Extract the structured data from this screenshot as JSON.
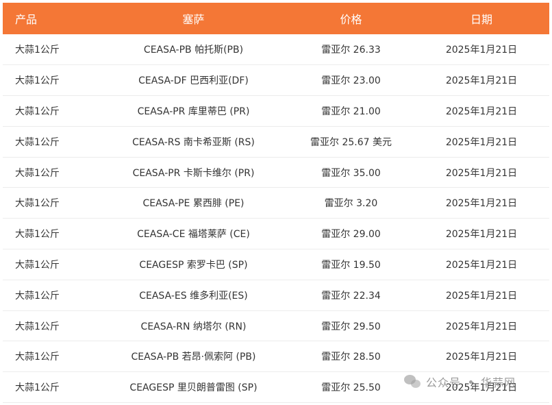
{
  "header": {
    "product": "产品",
    "market": "塞萨",
    "price": "价格",
    "date": "日期"
  },
  "rows": [
    {
      "product": "大蒜1公斤",
      "market": "CEASA-PB 帕托斯(PB)",
      "price": "雷亚尔 26.33",
      "date": "2025年1月21日"
    },
    {
      "product": "大蒜1公斤",
      "market": "CEASA-DF 巴西利亚(DF)",
      "price": "雷亚尔 23.00",
      "date": "2025年1月21日"
    },
    {
      "product": "大蒜1公斤",
      "market": "CEASA-PR 库里蒂巴 (PR)",
      "price": "雷亚尔 21.00",
      "date": "2025年1月21日"
    },
    {
      "product": "大蒜1公斤",
      "market": "CEASA-RS 南卡希亚斯 (RS)",
      "price": "雷亚尔 25.67 美元",
      "date": "2025年1月21日"
    },
    {
      "product": "大蒜1公斤",
      "market": "CEASA-PR 卡斯卡维尔 (PR)",
      "price": "雷亚尔 35.00",
      "date": "2025年1月21日"
    },
    {
      "product": "大蒜1公斤",
      "market": "CEASA-PE 累西腓 (PE)",
      "price": "雷亚尔 3.20",
      "date": "2025年1月21日"
    },
    {
      "product": "大蒜1公斤",
      "market": "CEASA-CE 福塔莱萨 (CE)",
      "price": "雷亚尔 29.00",
      "date": "2025年1月21日"
    },
    {
      "product": "大蒜1公斤",
      "market": "CEAGESP 索罗卡巴 (SP)",
      "price": "雷亚尔 19.50",
      "date": "2025年1月21日"
    },
    {
      "product": "大蒜1公斤",
      "market": "CEASA-ES 维多利亚(ES)",
      "price": "雷亚尔 22.34",
      "date": "2025年1月21日"
    },
    {
      "product": "大蒜1公斤",
      "market": "CEASA-RN 纳塔尔 (RN)",
      "price": "雷亚尔 29.50",
      "date": "2025年1月21日"
    },
    {
      "product": "大蒜1公斤",
      "market": "CEASA-PB 若昂·佩索阿 (PB)",
      "price": "雷亚尔 28.50",
      "date": "2025年1月21日"
    },
    {
      "product": "大蒜1公斤",
      "market": "CEAGESP 里贝朗普雷图 (SP)",
      "price": "雷亚尔 25.50",
      "date": "2025年1月21日"
    }
  ],
  "watermark": {
    "account_type": "公众号",
    "name": "华蒜网",
    "icon": "wechat-icon"
  },
  "colors": {
    "header_bg": "#f47736",
    "header_text": "#ffffff",
    "row_text": "#333333",
    "row_border": "#ececec"
  }
}
